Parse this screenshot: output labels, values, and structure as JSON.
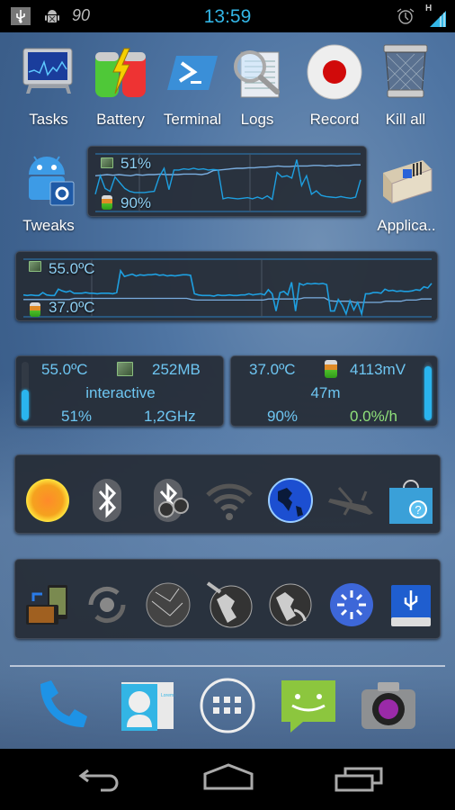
{
  "status_bar": {
    "time": "13:59",
    "left_icons": [
      "usb-icon",
      "android-debug-icon",
      "battery-percent-icon"
    ],
    "battery_notification_text": "90",
    "right_icons": [
      "alarm-icon",
      "signal-icon"
    ],
    "network_type": "H"
  },
  "shortcuts_row1": [
    {
      "label": "Tasks",
      "icon": "tasks-monitor-icon"
    },
    {
      "label": "Battery",
      "icon": "battery-charge-icon"
    },
    {
      "label": "Terminal",
      "icon": "terminal-icon"
    },
    {
      "label": "Logs",
      "icon": "logs-magnifier-icon"
    },
    {
      "label": "Record",
      "icon": "record-icon"
    },
    {
      "label": "Kill all",
      "icon": "trash-can-icon"
    }
  ],
  "shortcuts_row2": [
    {
      "label": "Tweaks",
      "icon": "android-tweaks-icon"
    },
    {
      "label": "Applica..",
      "icon": "toolbox-icon"
    }
  ],
  "usage_graph": {
    "cpu_label": "51%",
    "battery_label": "90%",
    "series_cpu": [
      12,
      13,
      14,
      13,
      14,
      13,
      12,
      14,
      13,
      14,
      14,
      15,
      14,
      14,
      14,
      15,
      15,
      15,
      14,
      16,
      21,
      22,
      23,
      24,
      25,
      25,
      26,
      26,
      27,
      27,
      28,
      29,
      28,
      28,
      29,
      29,
      29,
      30,
      30,
      29,
      30,
      29,
      30,
      30,
      31,
      31
    ],
    "series_battery": [
      30,
      62,
      40,
      35,
      60,
      50,
      40,
      35,
      33,
      33,
      33,
      34,
      35,
      60,
      75,
      38,
      72,
      72,
      74,
      73,
      75,
      73,
      74,
      72,
      73,
      72,
      22,
      24,
      23,
      22,
      23,
      24,
      22,
      25,
      22,
      27,
      21,
      68,
      60,
      62,
      58,
      90,
      45,
      62,
      30,
      36,
      28,
      26,
      25,
      24,
      26,
      24,
      23,
      25,
      55
    ]
  },
  "temp_graph": {
    "cpu_temp_label": "55.0ºC",
    "battery_temp_label": "37.0ºC",
    "series_cpu_temp": [
      38,
      37,
      38,
      37,
      37,
      42,
      38,
      37,
      37,
      48,
      45,
      43,
      45,
      41,
      41,
      41,
      42,
      41,
      41,
      40,
      41,
      41,
      41,
      40,
      42,
      80,
      70,
      72,
      74,
      71,
      73,
      72,
      73,
      73,
      74,
      72,
      73,
      71,
      72,
      71,
      72,
      73,
      73,
      72,
      40,
      38,
      37,
      37,
      37,
      36,
      38,
      37,
      37,
      38,
      37,
      37,
      38,
      38,
      40,
      38,
      39,
      40,
      38,
      47,
      40,
      10,
      42,
      44,
      38,
      60,
      10,
      58,
      55,
      58,
      57,
      58,
      57,
      58,
      56,
      10,
      10,
      30,
      20,
      5,
      28,
      12,
      25,
      5,
      40,
      40,
      42,
      42,
      41,
      48,
      45,
      46,
      44,
      45,
      44,
      44,
      45,
      47,
      46,
      52,
      50,
      58
    ],
    "series_batt_temp": [
      30,
      30,
      30,
      30,
      30,
      30,
      30,
      30,
      30,
      30,
      32,
      32,
      32,
      32,
      32,
      32,
      32,
      32,
      32,
      32,
      32,
      32,
      32,
      32,
      32,
      32,
      32,
      32,
      32,
      32,
      32,
      32,
      32,
      30,
      29,
      29,
      29,
      29,
      29,
      29,
      29,
      29,
      29,
      29,
      29,
      29,
      29,
      29,
      31,
      31,
      31,
      31,
      31,
      31,
      31,
      33,
      33,
      33,
      33,
      33,
      28,
      27,
      27,
      27,
      27,
      25,
      25,
      25,
      25,
      25,
      25,
      27,
      27,
      27,
      27,
      29,
      29,
      29,
      31,
      31,
      31
    ]
  },
  "cpu_widget": {
    "temperature": "55.0ºC",
    "memory": "252MB",
    "governor": "interactive",
    "load": "51%",
    "frequency": "1,2GHz",
    "load_fraction": 0.51,
    "icon": "cpu-chip-icon"
  },
  "battery_widget": {
    "temperature": "37.0ºC",
    "voltage": "4113mV",
    "time": "47m",
    "level": "90%",
    "rate": "0.0%/h",
    "level_fraction": 0.9,
    "icon": "battery-icon",
    "rate_color": "#8fe07a"
  },
  "toggles_row1": [
    {
      "name": "brightness-toggle",
      "icon": "sun-icon"
    },
    {
      "name": "bluetooth-toggle",
      "icon": "bluetooth-icon"
    },
    {
      "name": "bluetooth-discoverable-toggle",
      "icon": "bluetooth-binoculars-icon"
    },
    {
      "name": "wifi-toggle",
      "icon": "wifi-icon"
    },
    {
      "name": "mobile-data-toggle",
      "icon": "globe-icon"
    },
    {
      "name": "airplane-mode-toggle",
      "icon": "airplane-icon"
    },
    {
      "name": "market-help-toggle",
      "icon": "market-bag-icon"
    }
  ],
  "toggles_row2": [
    {
      "name": "auto-rotate-toggle",
      "icon": "rotate-phones-icon"
    },
    {
      "name": "sync-toggle",
      "icon": "sync-icon"
    },
    {
      "name": "network-globe-toggle",
      "icon": "network-globe-icon"
    },
    {
      "name": "gps-toggle",
      "icon": "satellite-globe-icon"
    },
    {
      "name": "wifi-hotspot-toggle",
      "icon": "hotspot-globe-icon"
    },
    {
      "name": "loading-toggle",
      "icon": "spinner-icon"
    },
    {
      "name": "usb-storage-toggle",
      "icon": "usb-drive-icon"
    }
  ],
  "dock": [
    {
      "name": "phone",
      "icon": "phone-icon"
    },
    {
      "name": "contacts",
      "icon": "contacts-icon",
      "card_text": "Lorem ipsum"
    },
    {
      "name": "app-drawer",
      "icon": "app-drawer-icon"
    },
    {
      "name": "messaging",
      "icon": "messaging-icon"
    },
    {
      "name": "camera",
      "icon": "camera-icon"
    }
  ],
  "nav": [
    "back",
    "home",
    "recent-apps"
  ],
  "colors": {
    "accent": "#33b5e5",
    "graph_line": "#1e9fe0",
    "graph_line2": "#7aaee0",
    "widget_bg": "#262c36",
    "text_blue": "#6ec6f2",
    "green": "#8fe07a"
  }
}
